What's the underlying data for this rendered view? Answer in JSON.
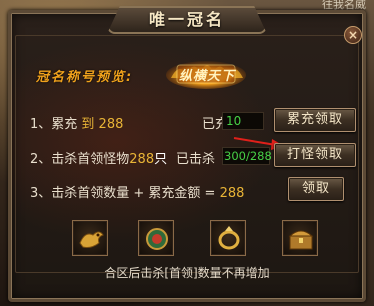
{
  "background": {
    "corner_text": "往我名威"
  },
  "panel": {
    "title": "唯一冠名",
    "close_symbol": "×"
  },
  "preview": {
    "label": "冠名称号预览:",
    "badge_text": "纵横天下"
  },
  "rows": [
    {
      "prefix": "1、累充",
      "target": "到 288",
      "status_label": "已充值",
      "status_value": "10",
      "button_label": "累充领取"
    },
    {
      "prefix": "2、击杀首领怪物",
      "target": "288",
      "unit": "只",
      "status_label": "已击杀",
      "status_value": "300/288",
      "button_label": "打怪领取"
    },
    {
      "prefix": "3、击杀首领数量 + 累充金额 =",
      "target": "288",
      "button_label": "领取"
    }
  ],
  "rewards": [
    {
      "icon": "golden-dragon-icon"
    },
    {
      "icon": "jade-orb-icon"
    },
    {
      "icon": "golden-ring-icon"
    },
    {
      "icon": "treasure-chest-icon"
    }
  ],
  "footer_note": "合区后击杀[首领]数量不再增加",
  "colors": {
    "gold": "#e8b436",
    "green": "#46d046",
    "orange": "#f0a21c"
  }
}
